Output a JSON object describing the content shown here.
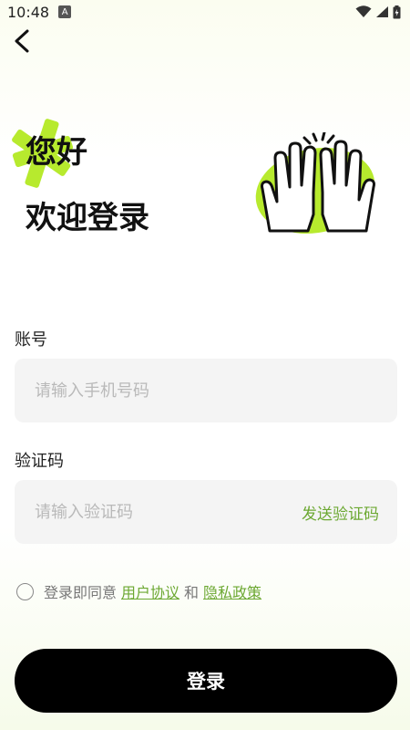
{
  "status_bar": {
    "time": "10:48",
    "notification_icon": "A"
  },
  "header": {
    "greeting": "您好",
    "welcome": "欢迎登录"
  },
  "account": {
    "label": "账号",
    "placeholder": "请输入手机号码",
    "value": ""
  },
  "code": {
    "label": "验证码",
    "placeholder": "请输入验证码",
    "value": "",
    "send_label": "发送验证码"
  },
  "agreement": {
    "prefix": "登录即同意",
    "user_agreement": "用户协议",
    "conjunction": "和",
    "privacy_policy": "隐私政策",
    "checked": false
  },
  "login_button": "登录",
  "colors": {
    "accent": "#6ca832",
    "highlight": "#b7ea2e",
    "button_bg": "#000000"
  }
}
